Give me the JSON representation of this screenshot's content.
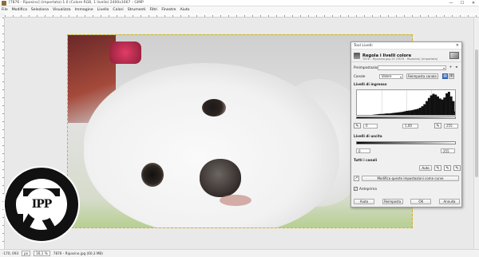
{
  "window": {
    "title": "[7876 - Riposino] (importata)-1.0 (Colore RGB, 1 livello) 2400x1667 – GIMP",
    "controls": {
      "minimize": "—",
      "maximize": "☐",
      "close": "✕"
    }
  },
  "menu": [
    "File",
    "Modifica",
    "Seleziona",
    "Visualizza",
    "Immagine",
    "Livello",
    "Colori",
    "Strumenti",
    "Filtri",
    "Finestre",
    "Aiuto"
  ],
  "logo": {
    "text": "IPP"
  },
  "status": {
    "coords": "-170, 093",
    "unit": "px",
    "zoom": "16,1 %",
    "file": "7876 - Riposino.jpg (60,3 MB)"
  },
  "dialog": {
    "window_title": "Tool Livelli",
    "header_title": "Regola i livelli colore",
    "header_subtitle": "7876 - Riposino.jpg-13 (7876 - Riposino) (importata)",
    "presets_label": "Preimpostazioni:",
    "channel_label": "Canale",
    "channel_value": "Valore",
    "reset_channel": "Reimposta canale",
    "input_levels": "Livelli di ingresso",
    "input_low": "0",
    "input_gamma": "1,00",
    "input_high": "255",
    "output_levels": "Livelli di uscita",
    "output_low": "0",
    "output_high": "255",
    "all_channels": "Tutti i canali",
    "auto": "Auto",
    "edit_curves": "Modifica queste impostazioni come curve",
    "preview": "Anteprima",
    "help": "Aiuto",
    "reset": "Reimposta",
    "ok": "OK",
    "cancel": "Annulla"
  },
  "histogram": {
    "values": [
      2,
      2,
      3,
      4,
      5,
      5,
      6,
      7,
      8,
      9,
      10,
      10,
      11,
      12,
      12,
      13,
      14,
      15,
      16,
      17,
      18,
      20,
      22,
      23,
      24,
      26,
      28,
      30,
      34,
      40,
      48,
      60,
      72,
      82,
      88,
      85,
      78,
      70,
      66,
      74,
      90,
      96,
      78,
      60,
      20
    ]
  }
}
